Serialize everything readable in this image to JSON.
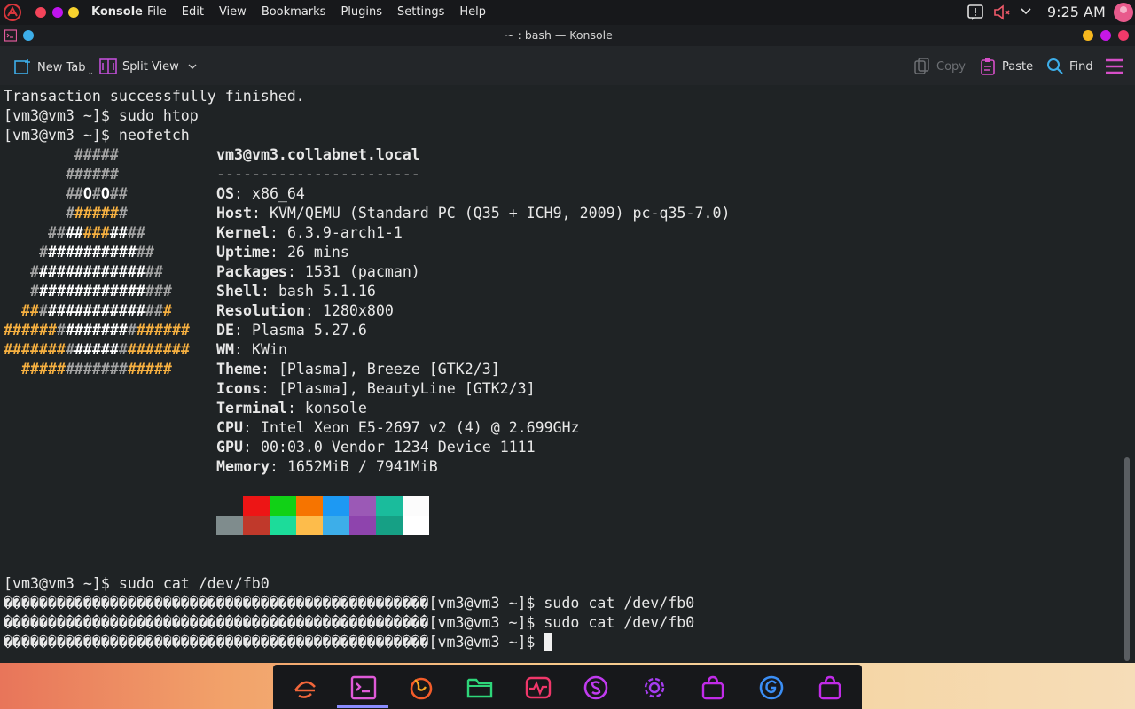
{
  "topbar": {
    "app_name": "Konsole",
    "menu": [
      "File",
      "Edit",
      "View",
      "Bookmarks",
      "Plugins",
      "Settings",
      "Help"
    ],
    "clock": "9:25 AM",
    "icons": [
      "arch-logo-icon",
      "notification-icon",
      "volume-muted-icon",
      "chevron-down-icon",
      "user-avatar"
    ]
  },
  "window": {
    "title": "~ : bash — Konsole"
  },
  "toolbar": {
    "new_tab": "New Tab",
    "split_view": "Split View",
    "copy": "Copy",
    "paste": "Paste",
    "find": "Find"
  },
  "terminal": {
    "lines_top": [
      "Transaction successfully finished.",
      "[vm3@vm3 ~]$ sudo htop",
      "[vm3@vm3 ~]$ neofetch"
    ],
    "neofetch": {
      "user_host": "vm3@vm3.collabnet.local",
      "separator": "-----------------------",
      "info": [
        {
          "key": "OS",
          "value": "x86_64"
        },
        {
          "key": "Host",
          "value": "KVM/QEMU (Standard PC (Q35 + ICH9, 2009) pc-q35-7.0)"
        },
        {
          "key": "Kernel",
          "value": "6.3.9-arch1-1"
        },
        {
          "key": "Uptime",
          "value": "26 mins"
        },
        {
          "key": "Packages",
          "value": "1531 (pacman)"
        },
        {
          "key": "Shell",
          "value": "bash 5.1.16"
        },
        {
          "key": "Resolution",
          "value": "1280x800"
        },
        {
          "key": "DE",
          "value": "Plasma 5.27.6"
        },
        {
          "key": "WM",
          "value": "KWin"
        },
        {
          "key": "Theme",
          "value": "[Plasma], Breeze [GTK2/3]"
        },
        {
          "key": "Icons",
          "value": "[Plasma], BeautyLine [GTK2/3]"
        },
        {
          "key": "Terminal",
          "value": "konsole"
        },
        {
          "key": "CPU",
          "value": "Intel Xeon E5-2697 v2 (4) @ 2.699GHz"
        },
        {
          "key": "GPU",
          "value": "00:03.0 Vendor 1234 Device 1111"
        },
        {
          "key": "Memory",
          "value": "1652MiB / 7941MiB"
        }
      ],
      "palette_top": [
        "#1f2325",
        "#ed1515",
        "#11d116",
        "#f67400",
        "#1d99f3",
        "#9b59b6",
        "#1abc9c",
        "#fcfcfc"
      ],
      "palette_bottom": [
        "#7f8c8d",
        "#c0392b",
        "#1cdc9a",
        "#fdbc4b",
        "#3daee9",
        "#8e44ad",
        "#16a085",
        "#ffffff"
      ]
    },
    "lines_bottom": [
      "[vm3@vm3 ~]$ sudo cat /dev/fb0",
      "������������������������������������������������[vm3@vm3 ~]$ sudo cat /dev/fb0",
      "������������������������������������������������[vm3@vm3 ~]$ sudo cat /dev/fb0",
      "������������������������������������������������[vm3@vm3 ~]$ "
    ]
  },
  "dock": {
    "items": [
      "app-launcher-icon",
      "konsole-icon",
      "firefox-icon",
      "files-icon",
      "system-monitor-icon",
      "store-icon",
      "settings-icon",
      "bag-icon",
      "browser-icon",
      "bag-icon-2"
    ]
  }
}
